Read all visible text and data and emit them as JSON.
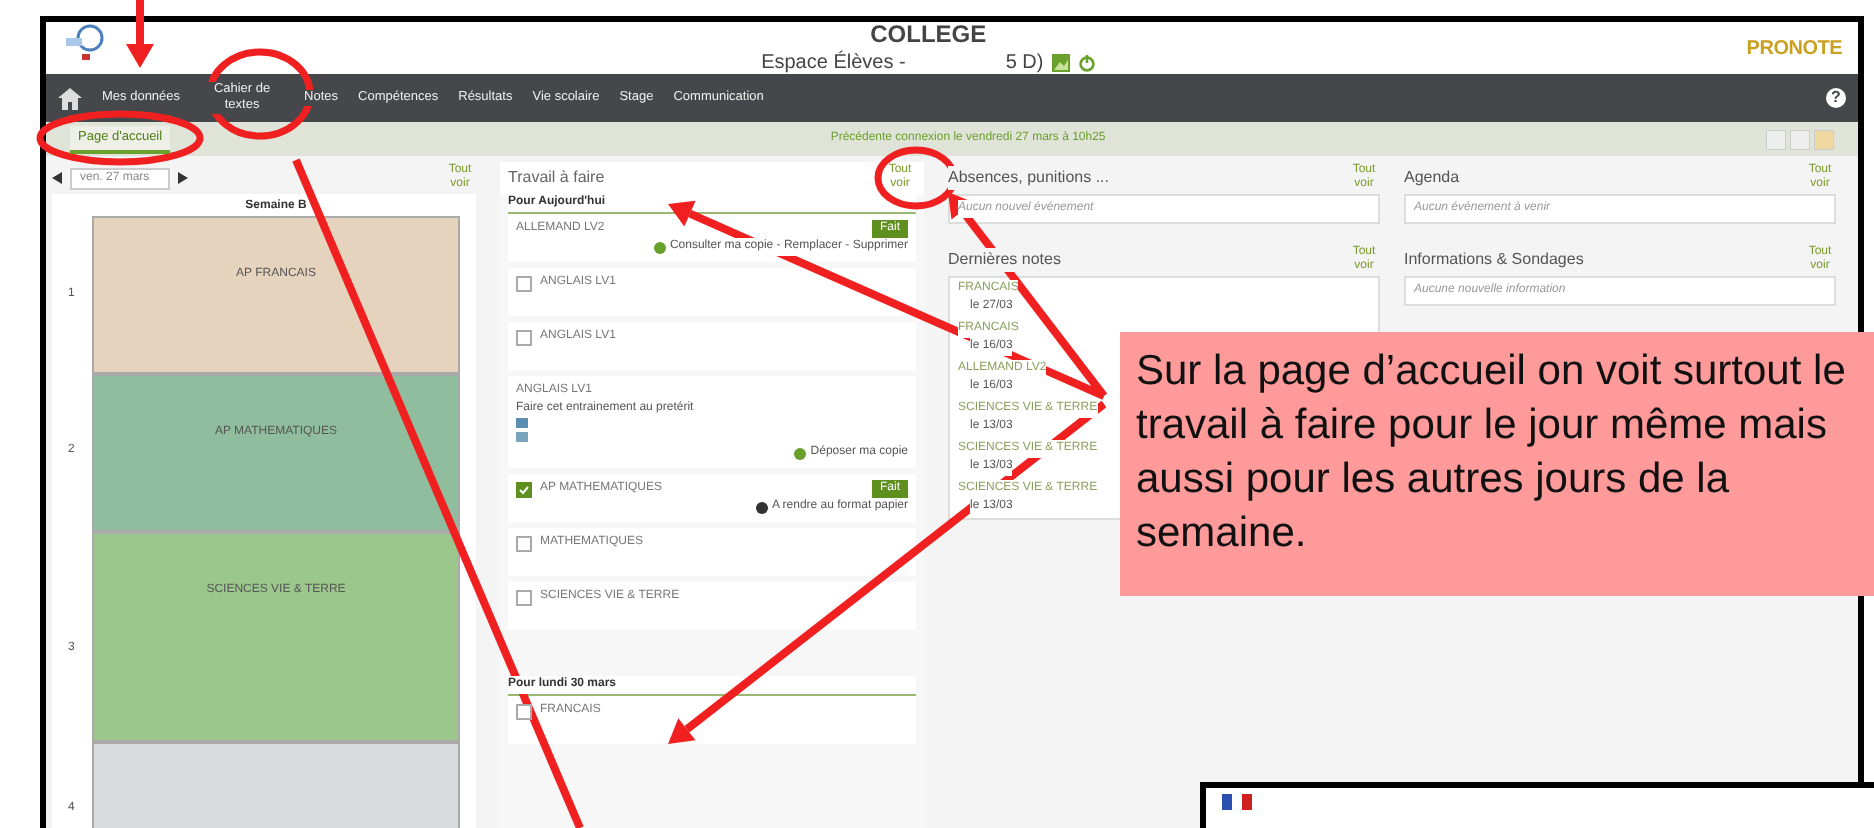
{
  "header": {
    "school": "COLLEGE",
    "subtitle": "Espace Élèves -",
    "class_suffix": "5 D)",
    "logo": "PRONOTE"
  },
  "nav": [
    "Mes données",
    "Cahier de textes",
    "Notes",
    "Compétences",
    "Résultats",
    "Vie scolaire",
    "Stage",
    "Communication"
  ],
  "tabs": [
    {
      "label": "Page d'accueil",
      "selected": true
    }
  ],
  "last_connection": "Précédente connexion le vendredi 27 mars à 10h25",
  "timetable": {
    "date": "ven. 27 mars",
    "see_all": "Tout voir",
    "week": "Semaine B",
    "hours": [
      "1",
      "2",
      "3",
      "4"
    ],
    "lessons": [
      {
        "subject": "AP FRANCAIS",
        "color": "#e6d3be"
      },
      {
        "subject": "AP MATHEMATIQUES",
        "color": "#8fbd9d"
      },
      {
        "subject": "SCIENCES VIE & TERRE",
        "color": "#9bc68c"
      },
      {
        "color": "#d9dadc"
      }
    ]
  },
  "homework": {
    "title": "Travail à faire",
    "see_all": "Tout voir",
    "sections": [
      {
        "heading": "Pour Aujourd'hui",
        "items": [
          {
            "subject": "ALLEMAND LV2",
            "badge": "Fait",
            "action": "Consulter ma copie - Remplacer - Supprimer"
          },
          {
            "subject": "ANGLAIS LV1",
            "checked": false
          },
          {
            "subject": "ANGLAIS LV1",
            "checked": false
          },
          {
            "subject": "ANGLAIS LV1",
            "description": "Faire cet entrainement au pretérit",
            "action": "Déposer ma copie"
          },
          {
            "subject": "AP MATHEMATIQUES",
            "checked": true,
            "badge": "Fait",
            "action": "A rendre au format papier"
          },
          {
            "subject": "MATHEMATIQUES",
            "checked": false
          },
          {
            "subject": "SCIENCES VIE & TERRE",
            "checked": false
          }
        ]
      },
      {
        "heading": "Pour lundi 30 mars",
        "items": [
          {
            "subject": "FRANCAIS",
            "checked": false
          }
        ]
      }
    ]
  },
  "panels": [
    {
      "title": "Absences, punitions ...",
      "see_all": "Tout voir",
      "empty": "Aucun nouvel événement"
    },
    {
      "title": "Agenda",
      "see_all": "Tout voir",
      "empty": "Aucun événement à venir"
    },
    {
      "title": "Dernières notes",
      "see_all": "Tout voir",
      "notes": [
        {
          "subject": "FRANCAIS",
          "date": "le 27/03"
        },
        {
          "subject": "FRANCAIS",
          "date": "le 16/03"
        },
        {
          "subject": "ALLEMAND LV2",
          "date": "le 16/03"
        },
        {
          "subject": "SCIENCES VIE & TERRE",
          "date": "le 13/03"
        },
        {
          "subject": "SCIENCES VIE & TERRE",
          "date": "le 13/03"
        },
        {
          "subject": "SCIENCES VIE & TERRE",
          "date": "le 13/03"
        }
      ]
    },
    {
      "title": "Informations & Sondages",
      "see_all": "Tout voir",
      "empty": "Aucune nouvelle information"
    }
  ],
  "help_symbol": "?",
  "callout": "Sur la page d’accueil on voit surtout le travail à faire pour le jour même mais aussi pour les autres jours de la semaine."
}
